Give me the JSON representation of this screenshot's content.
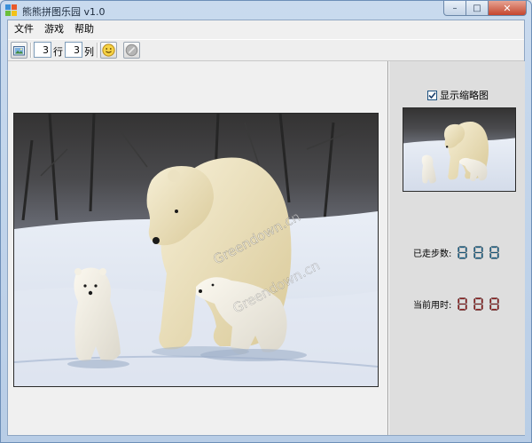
{
  "window": {
    "title": "熊熊拼图乐园 v1.0",
    "controls": {
      "minimize": "–",
      "maximize": "□",
      "close": "✕"
    }
  },
  "menu": {
    "items": [
      "文件",
      "游戏",
      "帮助"
    ]
  },
  "toolbar": {
    "rows_value": "3",
    "rows_label": "行",
    "cols_value": "3",
    "cols_label": "列",
    "open_icon": "picture-folder-icon",
    "start_icon": "smiley-icon",
    "stop_icon": "disabled-circle-icon"
  },
  "sidebar": {
    "show_thumbnail_label": "显示缩略图",
    "show_thumbnail_checked": true,
    "steps_label": "已走步数:",
    "time_label": "当前用时:",
    "steps_value": "888",
    "time_value": "888"
  },
  "image": {
    "watermark": "Greendown.cn",
    "description_icon": "polar-bear-photo"
  },
  "colors": {
    "steps_digit": "#1f6f9a",
    "time_digit": "#9c1c1c",
    "accent": "#6d8fb8"
  }
}
